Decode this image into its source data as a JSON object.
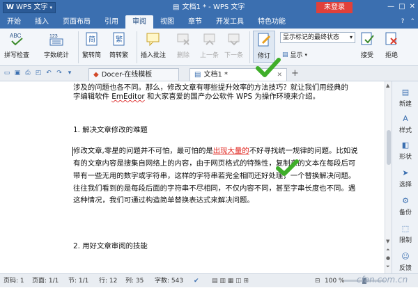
{
  "app": {
    "logo": "WPS 文字",
    "doc_title": "文档1 * - WPS 文字",
    "login": "未登录",
    "ctrl_min": "—",
    "ctrl_max": "□",
    "ctrl_close": "✕"
  },
  "ribbon_tabs": [
    "开始",
    "插入",
    "页面布局",
    "引用",
    "审阅",
    "视图",
    "章节",
    "开发工具",
    "特色功能"
  ],
  "ribbon_active": "审阅",
  "ribbon": {
    "spell": "拼写检查",
    "wordcount": "字数统计",
    "t2s": "繁转简",
    "s2t": "简转繁",
    "insert_comment": "插入批注",
    "delete": "删除",
    "prev": "上一条",
    "next": "下一条",
    "track": "修订",
    "display_select": "显示标记的最终状态",
    "display": "显示",
    "accept": "接受",
    "reject": "拒绝",
    "abc": "ABC",
    "counter": "123"
  },
  "doc_tabs": {
    "template": "Docer-在线模板",
    "doc": "文档1 *"
  },
  "document": {
    "line1": "涉及的问题也各不同。那么，修改文章有哪些提升效率的方法技巧？就让我们用经典的",
    "line2a": "字编辑软件 ",
    "line2b": "EmEditor",
    "line2c": " 和大家喜爱的国产办公软件 WPS 为操作环境来介绍。",
    "heading1": "1. 解决文章修改的难题",
    "p1a": "修改文章,零星的问题并不可怕，最可怕的是",
    "p1b": "出现大量的",
    "p1c": "不好寻找统一规律的问题。比如说",
    "p2": "有的文章内容是搜集自网络上的内容，由于网页格式的特殊性，复制来的文本在每段后可",
    "p3": "带有一些无用的数字或字符串，这样的字符串若完全相同还好处理，一个替换解决问题。",
    "p4": "往往我们看到的是每段后面的字符串不尽相同，不仅内容不同，甚至字串长度也不同。遇",
    "p5": "这种情况，我们可通过构造简单替换表达式来解决问题。",
    "heading2": "2. 用好文章审阅的技能"
  },
  "sidepane": [
    "新建",
    "样式",
    "形状",
    "选择",
    "备份",
    "限制",
    "反馈"
  ],
  "status": {
    "page": "页码: 1",
    "pages": "页面: 1/1",
    "section": "节: 1/1",
    "row": "行: 12",
    "col": "列: 35",
    "words": "字数: 543",
    "zoom": "100 %",
    "watermark": "cfan.com.cn"
  },
  "colors": {
    "accent": "#3b6fb0",
    "check": "#3fae2a"
  }
}
